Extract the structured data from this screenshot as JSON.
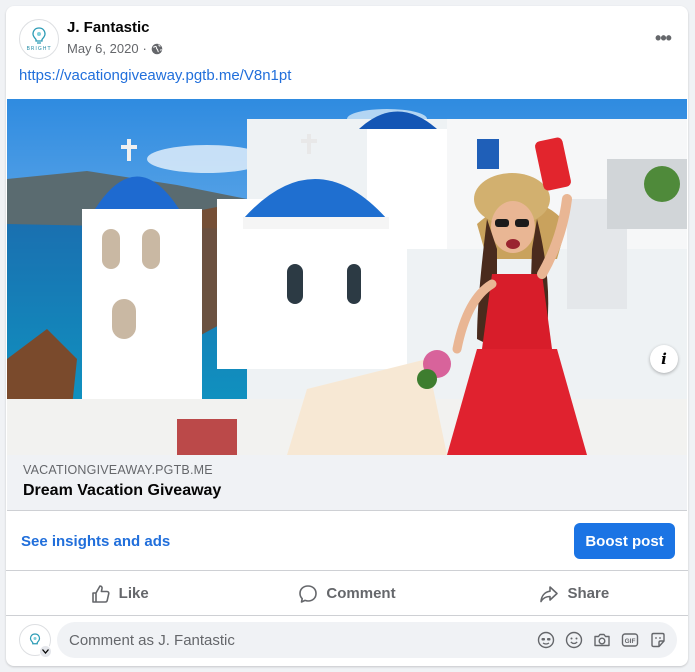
{
  "post": {
    "author": "J. Fantastic",
    "date": "May 6, 2020",
    "date_separator": "·",
    "avatar_text": "BRIGHT",
    "link_url": "https://vacationgiveaway.pgtb.me/V8n1pt",
    "more_label": "•••"
  },
  "link_preview": {
    "domain": "VACATIONGIVEAWAY.PGTB.ME",
    "title": "Dream Vacation Giveaway",
    "info_label": "i"
  },
  "insights": {
    "link_label": "See insights and ads",
    "boost_label": "Boost post"
  },
  "actions": {
    "like": "Like",
    "comment": "Comment",
    "share": "Share"
  },
  "comment": {
    "placeholder": "Comment as J. Fantastic",
    "icons": [
      "avatar-sticker-icon",
      "emoji-icon",
      "camera-icon",
      "gif-icon",
      "sticker-icon"
    ],
    "gif_label": "GIF"
  },
  "colors": {
    "accent": "#1b74e4",
    "link": "#216fdb",
    "secondary_text": "#65676b"
  }
}
